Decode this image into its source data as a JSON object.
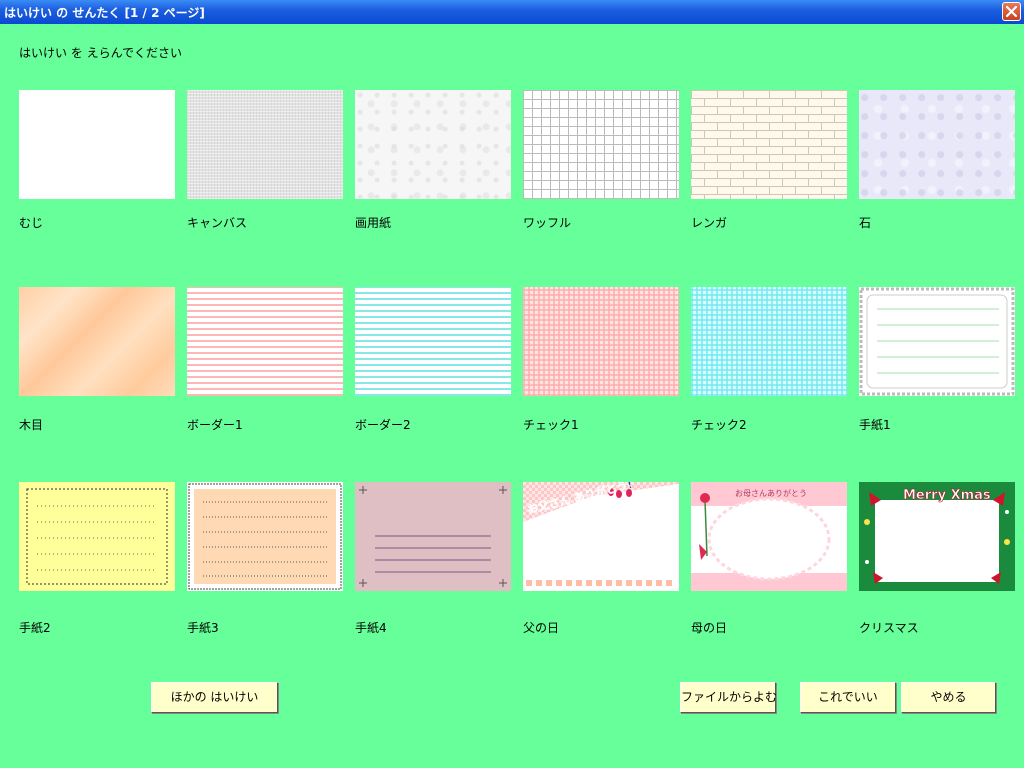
{
  "window": {
    "title": "はいけい の せんたく [1 / 2 ページ]"
  },
  "instruction": "はいけい を えらんでください",
  "backgrounds": [
    {
      "label": "むじ",
      "icon": "plain-white"
    },
    {
      "label": "キャンバス",
      "icon": "canvas-texture"
    },
    {
      "label": "画用紙",
      "icon": "drawing-paper-texture"
    },
    {
      "label": "ワッフル",
      "icon": "waffle-grid"
    },
    {
      "label": "レンガ",
      "icon": "brick-pattern"
    },
    {
      "label": "石",
      "icon": "stone-texture"
    },
    {
      "label": "木目",
      "icon": "wood-grain"
    },
    {
      "label": "ボーダー1",
      "icon": "pink-stripes"
    },
    {
      "label": "ボーダー2",
      "icon": "cyan-stripes"
    },
    {
      "label": "チェック1",
      "icon": "pink-check"
    },
    {
      "label": "チェック2",
      "icon": "cyan-check"
    },
    {
      "label": "手紙1",
      "icon": "letter-frame-green-lines"
    },
    {
      "label": "手紙2",
      "icon": "letter-yellow-dotted"
    },
    {
      "label": "手紙3",
      "icon": "letter-peach-dotted"
    },
    {
      "label": "手紙4",
      "icon": "letter-mauve-lines"
    },
    {
      "label": "父の日",
      "icon": "fathers-day-card",
      "text": "お父さん ありがとう!"
    },
    {
      "label": "母の日",
      "icon": "mothers-day-card",
      "text": "お母さんありがとう"
    },
    {
      "label": "クリスマス",
      "icon": "christmas-card",
      "text": "Merry Xmas"
    }
  ],
  "buttons": {
    "other": "ほかの はいけい",
    "from_file": "ファイルからよむ",
    "ok": "これでいい",
    "cancel": "やめる"
  }
}
